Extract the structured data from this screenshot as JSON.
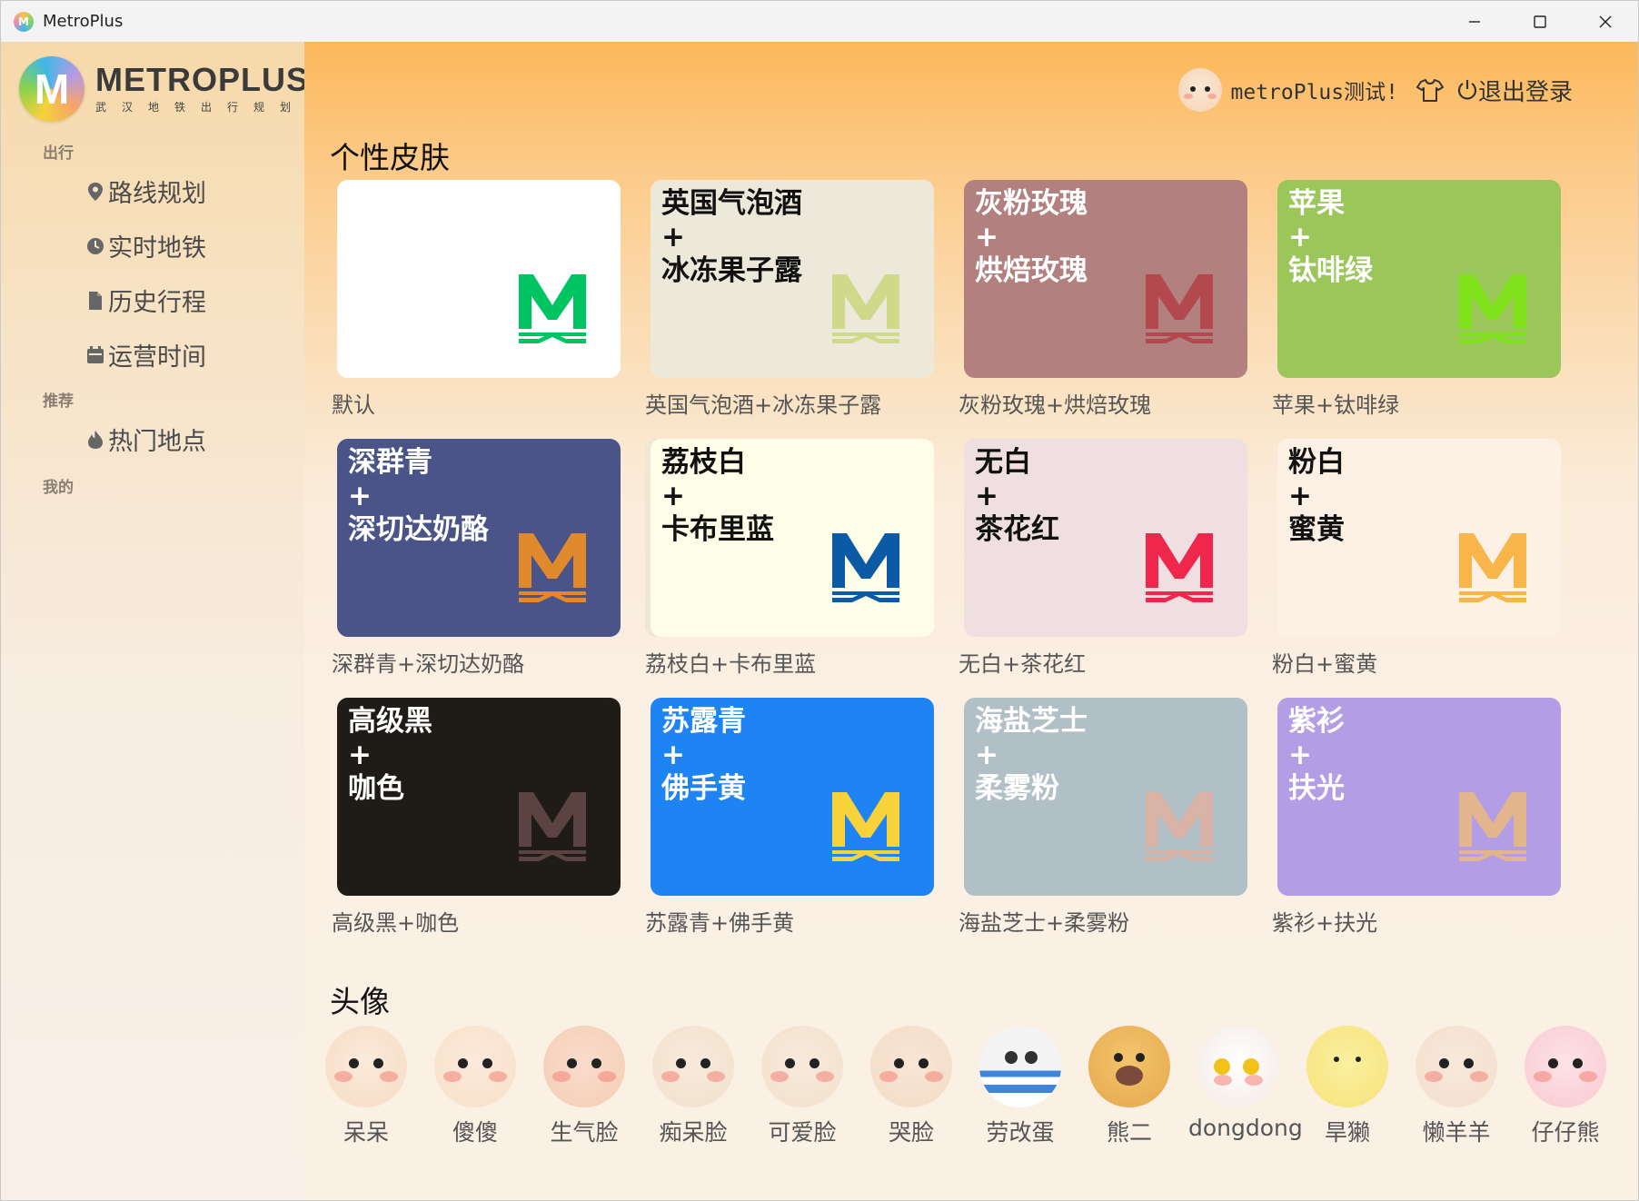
{
  "window": {
    "title": "MetroPlus"
  },
  "logo": {
    "title": "METROPLUS",
    "subtitle": "武汉地铁出行规划"
  },
  "sidebar": {
    "sections": [
      {
        "label": "出行"
      },
      {
        "label": "推荐"
      },
      {
        "label": "我的"
      }
    ],
    "items": [
      {
        "label": "路线规划",
        "icon": "location-pin-icon"
      },
      {
        "label": "实时地铁",
        "icon": "clock-icon"
      },
      {
        "label": "历史行程",
        "icon": "document-icon"
      },
      {
        "label": "运营时间",
        "icon": "calendar-icon"
      },
      {
        "label": "热门地点",
        "icon": "fire-icon"
      }
    ]
  },
  "header": {
    "username": "metroPlus测试!",
    "logout_label": "退出登录"
  },
  "skins": {
    "title": "个性皮肤",
    "items": [
      {
        "line1": "",
        "plus": "",
        "line2": "",
        "caption": "默认",
        "bg": "#ffffff",
        "fg": "#111111",
        "logo": "#00c462"
      },
      {
        "line1": "英国气泡酒",
        "plus": "+",
        "line2": "冰冻果子露",
        "caption": "英国气泡酒+冰冻果子露",
        "bg": "#ece8da",
        "fg": "#111111",
        "logo": "#cfd98a"
      },
      {
        "line1": "灰粉玫瑰",
        "plus": "+",
        "line2": "烘焙玫瑰",
        "caption": "灰粉玫瑰+烘焙玫瑰",
        "bg": "#b1807f",
        "fg": "#ffffff",
        "logo": "#b3484e"
      },
      {
        "line1": "苹果",
        "plus": "+",
        "line2": "钛啡绿",
        "caption": "苹果+钛啡绿",
        "bg": "#9ac65a",
        "fg": "#ffffff",
        "logo": "#7fe21b"
      },
      {
        "line1": "深群青",
        "plus": "+",
        "line2": "深切达奶酪",
        "caption": "深群青+深切达奶酪",
        "bg": "#4a5488",
        "fg": "#ffffff",
        "logo": "#e08a2d"
      },
      {
        "line1": "荔枝白",
        "plus": "+",
        "line2": "卡布里蓝",
        "caption": "荔枝白+卡布里蓝",
        "bg": "#fefde8",
        "fg": "#111111",
        "logo": "#0b5aa5"
      },
      {
        "line1": "无白",
        "plus": "+",
        "line2": "茶花红",
        "caption": "无白+茶花红",
        "bg": "#f0dfe0",
        "fg": "#111111",
        "logo": "#f0274d"
      },
      {
        "line1": "粉白",
        "plus": "+",
        "line2": "蜜黄",
        "caption": "粉白+蜜黄",
        "bg": "#fdf1e6",
        "fg": "#111111",
        "logo": "#f7b54a"
      },
      {
        "line1": "高级黑",
        "plus": "+",
        "line2": "咖色",
        "caption": "高级黑+咖色",
        "bg": "#1f1c17",
        "fg": "#ffffff",
        "logo": "#5a4340"
      },
      {
        "line1": "苏露青",
        "plus": "+",
        "line2": "佛手黄",
        "caption": "苏露青+佛手黄",
        "bg": "#1f84f3",
        "fg": "#ffffff",
        "logo": "#f7d239"
      },
      {
        "line1": "海盐芝士",
        "plus": "+",
        "line2": "柔雾粉",
        "caption": "海盐芝士+柔雾粉",
        "bg": "#b1bfc6",
        "fg": "#ffffff",
        "logo": "#d8b3a6"
      },
      {
        "line1": "紫衫",
        "plus": "+",
        "line2": "扶光",
        "caption": "紫衫+扶光",
        "bg": "#b39de4",
        "fg": "#ffffff",
        "logo": "#e3b58c"
      }
    ]
  },
  "avatars": {
    "title": "头像",
    "items": [
      {
        "label": "呆呆",
        "icon": "dull-face-icon"
      },
      {
        "label": "傻傻",
        "icon": "silly-face-icon"
      },
      {
        "label": "生气脸",
        "icon": "angry-face-icon"
      },
      {
        "label": "痴呆脸",
        "icon": "dazed-face-icon"
      },
      {
        "label": "可爱脸",
        "icon": "cute-face-icon"
      },
      {
        "label": "哭脸",
        "icon": "crying-face-icon"
      },
      {
        "label": "劳改蛋",
        "icon": "prisoner-egg-icon"
      },
      {
        "label": "熊二",
        "icon": "bear-icon"
      },
      {
        "label": "dongdong",
        "icon": "dongdong-sunglasses-icon"
      },
      {
        "label": "旱獭",
        "icon": "marmot-icon"
      },
      {
        "label": "懒羊羊",
        "icon": "lazy-sheep-icon"
      },
      {
        "label": "仔仔熊",
        "icon": "pink-bear-icon"
      }
    ]
  }
}
